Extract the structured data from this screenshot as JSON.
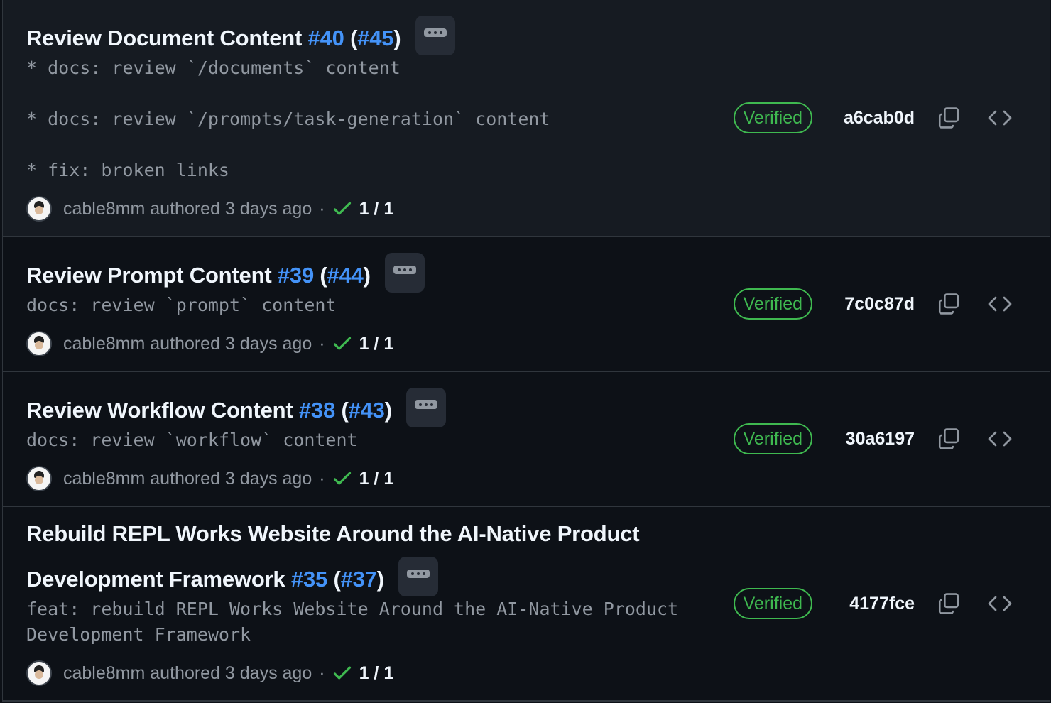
{
  "commits": [
    {
      "title": "Review Document Content",
      "pr": "#40",
      "merged": "#45",
      "body": "* docs: review `/documents` content\n\n* docs: review `/prompts/task-generation` content\n\n* fix: broken links",
      "author": "cable8mm",
      "authored": "authored 3 days ago",
      "separator": "·",
      "checks": "1 / 1",
      "badge": "Verified",
      "sha": "a6cab0d"
    },
    {
      "title": "Review Prompt Content",
      "pr": "#39",
      "merged": "#44",
      "body": "docs: review `prompt` content",
      "author": "cable8mm",
      "authored": "authored 3 days ago",
      "separator": "·",
      "checks": "1 / 1",
      "badge": "Verified",
      "sha": "7c0c87d"
    },
    {
      "title": "Review Workflow Content",
      "pr": "#38",
      "merged": "#43",
      "body": "docs: review `workflow` content",
      "author": "cable8mm",
      "authored": "authored 3 days ago",
      "separator": "·",
      "checks": "1 / 1",
      "badge": "Verified",
      "sha": "30a6197"
    },
    {
      "title_line1": "Rebuild REPL Works Website Around the AI-Native Product",
      "title_line2": "Development Framework",
      "pr": "#35",
      "merged": "#37",
      "body": "feat: rebuild REPL Works Website Around the AI-Native Product\nDevelopment Framework",
      "author": "cable8mm",
      "authored": "authored 3 days ago",
      "separator": "·",
      "checks": "1 / 1",
      "badge": "Verified",
      "sha": "4177fce"
    }
  ],
  "colors": {
    "background": "#0d1117",
    "selected_row": "#161b22",
    "link": "#4493f8",
    "verified": "#3fb950",
    "muted": "#9198a1"
  },
  "icons": {
    "expand": "ellipsis-icon",
    "copy": "copy-icon",
    "browse": "code-icon",
    "check": "check-icon"
  }
}
